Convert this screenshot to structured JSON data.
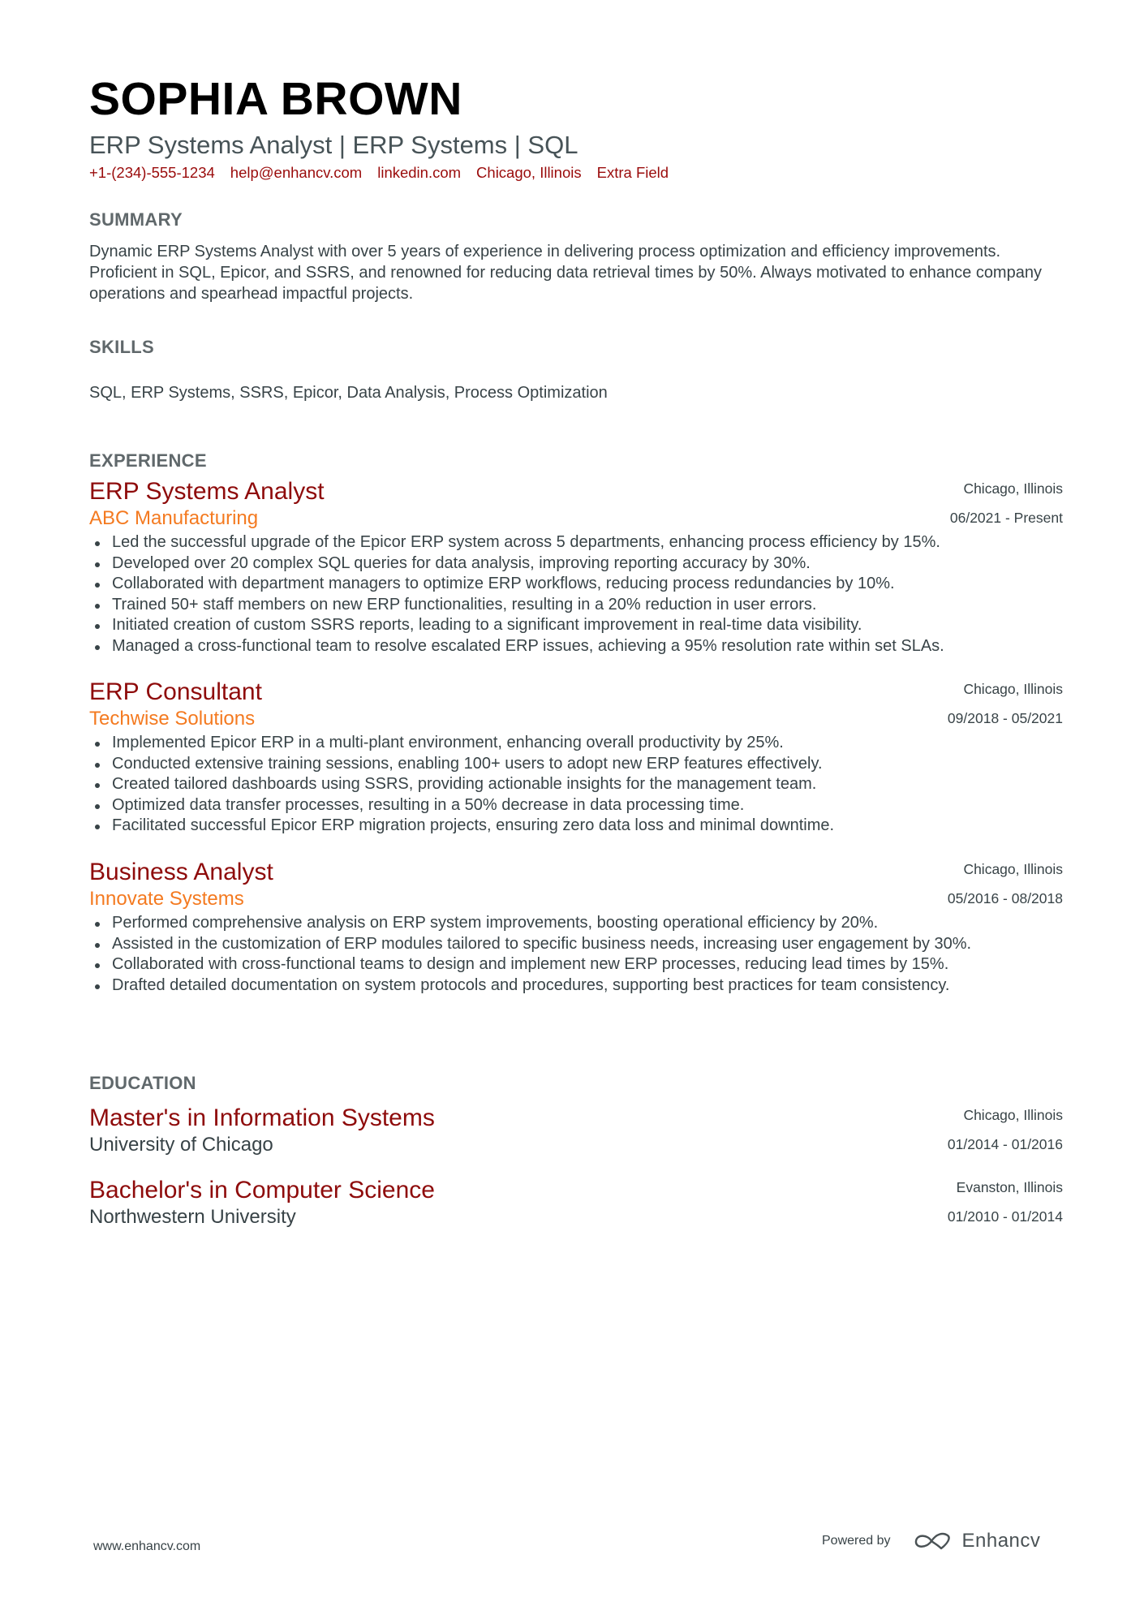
{
  "header": {
    "name": "SOPHIA BROWN",
    "subtitle": "ERP Systems Analyst | ERP Systems | SQL",
    "contacts": [
      "+1-(234)-555-1234",
      "help@enhancv.com",
      "linkedin.com",
      "Chicago, Illinois",
      "Extra Field"
    ]
  },
  "summary": {
    "heading": "SUMMARY",
    "text": "Dynamic ERP Systems Analyst with over 5 years of experience in delivering process optimization and efficiency improvements. Proficient in SQL, Epicor, and SSRS, and renowned for reducing data retrieval times by 50%. Always motivated to enhance company operations and spearhead impactful projects."
  },
  "skills": {
    "heading": "SKILLS",
    "text": "SQL, ERP Systems, SSRS, Epicor, Data Analysis, Process Optimization"
  },
  "experience": {
    "heading": "EXPERIENCE",
    "items": [
      {
        "title": "ERP Systems Analyst",
        "company": "ABC Manufacturing",
        "location": "Chicago, Illinois",
        "dates": "06/2021 - Present",
        "bullets": [
          "Led the successful upgrade of the Epicor ERP system across 5 departments, enhancing process efficiency by 15%.",
          "Developed over 20 complex SQL queries for data analysis, improving reporting accuracy by 30%.",
          "Collaborated with department managers to optimize ERP workflows, reducing process redundancies by 10%.",
          "Trained 50+ staff members on new ERP functionalities, resulting in a 20% reduction in user errors.",
          "Initiated creation of custom SSRS reports, leading to a significant improvement in real-time data visibility.",
          "Managed a cross-functional team to resolve escalated ERP issues, achieving a 95% resolution rate within set SLAs."
        ]
      },
      {
        "title": "ERP Consultant",
        "company": "Techwise Solutions",
        "location": "Chicago, Illinois",
        "dates": "09/2018 - 05/2021",
        "bullets": [
          "Implemented Epicor ERP in a multi-plant environment, enhancing overall productivity by 25%.",
          "Conducted extensive training sessions, enabling 100+ users to adopt new ERP features effectively.",
          "Created tailored dashboards using SSRS, providing actionable insights for the management team.",
          "Optimized data transfer processes, resulting in a 50% decrease in data processing time.",
          "Facilitated successful Epicor ERP migration projects, ensuring zero data loss and minimal downtime."
        ]
      },
      {
        "title": "Business Analyst",
        "company": "Innovate Systems",
        "location": "Chicago, Illinois",
        "dates": "05/2016 - 08/2018",
        "bullets": [
          "Performed comprehensive analysis on ERP system improvements, boosting operational efficiency by 20%.",
          "Assisted in the customization of ERP modules tailored to specific business needs, increasing user engagement by 30%.",
          "Collaborated with cross-functional teams to design and implement new ERP processes, reducing lead times by 15%.",
          "Drafted detailed documentation on system protocols and procedures, supporting best practices for team consistency."
        ]
      }
    ]
  },
  "education": {
    "heading": "EDUCATION",
    "items": [
      {
        "degree": "Master's in Information Systems",
        "school": "University of Chicago",
        "location": "Chicago, Illinois",
        "dates": "01/2014 - 01/2016"
      },
      {
        "degree": "Bachelor's in Computer Science",
        "school": "Northwestern University",
        "location": "Evanston, Illinois",
        "dates": "01/2010 - 01/2014"
      }
    ]
  },
  "footer": {
    "website": "www.enhancv.com",
    "powered_by": "Powered by",
    "brand": "Enhancv",
    "brand_icon": "enhancv-infinity-heart-icon"
  },
  "colors": {
    "name": "#000000",
    "subtitle": "#475357",
    "contact": "#9a0b0b",
    "section_heading": "#60686b",
    "job_title": "#8e0b0b",
    "company": "#f47a20",
    "body_text": "#384347"
  }
}
